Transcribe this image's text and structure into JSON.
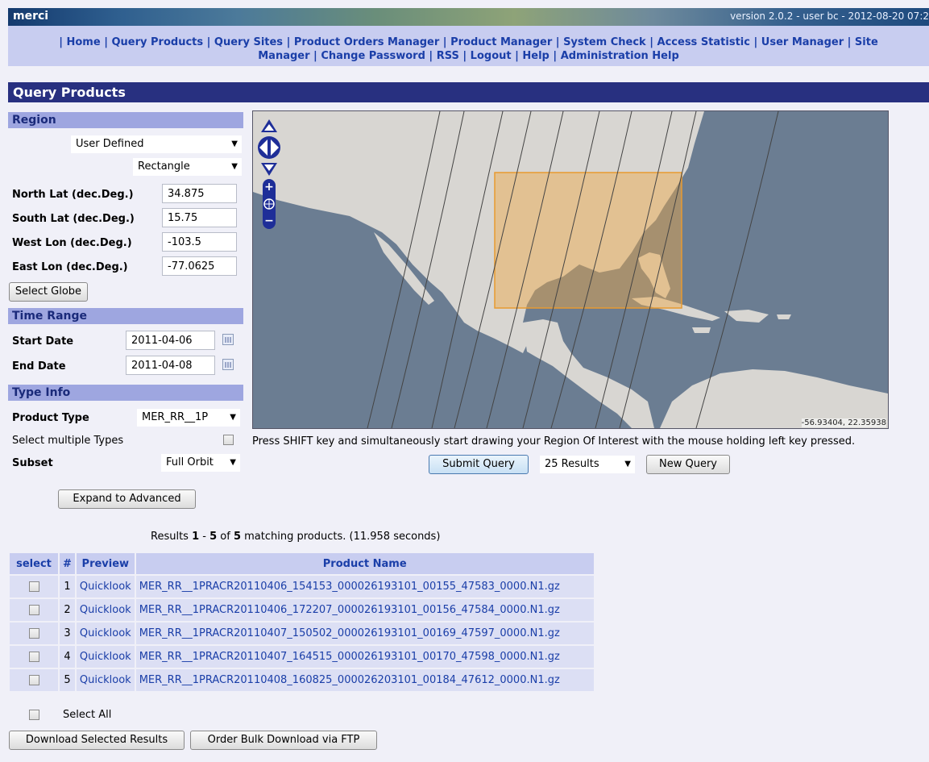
{
  "header": {
    "app_name": "merci",
    "version_user": "version 2.0.2 - user bc - 2012-08-20 07:2"
  },
  "nav": {
    "sep": "|",
    "items": [
      "Home",
      "Query Products",
      "Query Sites",
      "Product Orders Manager",
      "Product Manager",
      "System Check",
      "Access Statistic",
      "User Manager",
      "Site Manager",
      "Change Password",
      "RSS",
      "Logout",
      "Help",
      "Administration Help"
    ]
  },
  "page_title": "Query Products",
  "region": {
    "heading": "Region",
    "region_select": "User Defined",
    "shape_select": "Rectangle",
    "north_label": "North Lat (dec.Deg.)",
    "north_value": "34.875",
    "south_label": "South Lat (dec.Deg.)",
    "south_value": "15.75",
    "west_label": "West Lon (dec.Deg.)",
    "west_value": "-103.5",
    "east_label": "East Lon (dec.Deg.)",
    "east_value": "-77.0625",
    "globe_button": "Select Globe"
  },
  "time": {
    "heading": "Time Range",
    "start_label": "Start Date",
    "start_value": "2011-04-06",
    "end_label": "End Date",
    "end_value": "2011-04-08"
  },
  "type": {
    "heading": "Type Info",
    "product_label": "Product Type",
    "product_value": "MER_RR__1P",
    "multi_label": "Select multiple Types",
    "subset_label": "Subset",
    "subset_value": "Full Orbit",
    "expand_button": "Expand to Advanced"
  },
  "map": {
    "coords": "-56.93404, 22.35938",
    "hint": "Press SHIFT key and simultaneously start drawing your Region Of Interest with the mouse holding left key pressed."
  },
  "query": {
    "submit": "Submit Query",
    "results_count": "25 Results",
    "new_query": "New Query"
  },
  "results": {
    "summary_prefix": "Results ",
    "range_start": "1",
    "range_sep": " - ",
    "range_end": "5",
    "of": " of ",
    "total": "5",
    "summary_suffix": " matching products. (11.958 seconds)",
    "columns": [
      "select",
      "#",
      "Preview",
      "Product Name"
    ],
    "rows": [
      {
        "num": "1",
        "preview": "Quicklook",
        "name": "MER_RR__1PRACR20110406_154153_000026193101_00155_47583_0000.N1.gz"
      },
      {
        "num": "2",
        "preview": "Quicklook",
        "name": "MER_RR__1PRACR20110406_172207_000026193101_00156_47584_0000.N1.gz"
      },
      {
        "num": "3",
        "preview": "Quicklook",
        "name": "MER_RR__1PRACR20110407_150502_000026193101_00169_47597_0000.N1.gz"
      },
      {
        "num": "4",
        "preview": "Quicklook",
        "name": "MER_RR__1PRACR20110407_164515_000026193101_00170_47598_0000.N1.gz"
      },
      {
        "num": "5",
        "preview": "Quicklook",
        "name": "MER_RR__1PRACR20110408_160825_000026203101_00184_47612_0000.N1.gz"
      }
    ],
    "select_all": "Select All",
    "download_button": "Download Selected Results",
    "ftp_button": "Order Bulk Download via FTP"
  },
  "colors": {
    "nav_bg": "#c8cdf0",
    "title_bg": "#283080",
    "section_bg": "#9ea6e0",
    "link": "#1a3ea8",
    "ocean": "#6b7d92",
    "land": "#d8d6d2",
    "roi": "#f0a845"
  }
}
